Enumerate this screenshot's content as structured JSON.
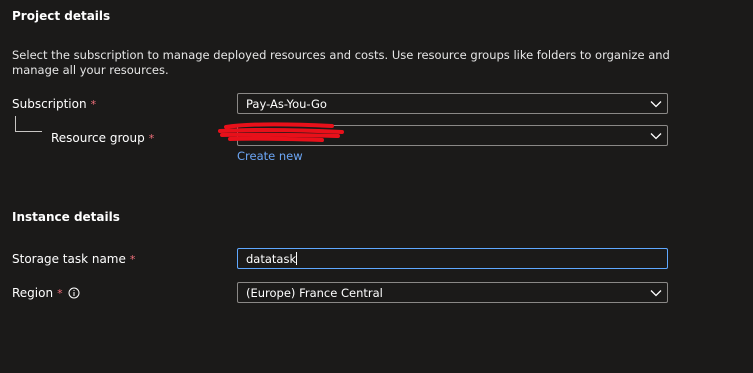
{
  "project": {
    "title": "Project details",
    "description": "Select the subscription to manage deployed resources and costs. Use resource groups like folders to organize and manage all your resources."
  },
  "subscription": {
    "label": "Subscription",
    "required": "*",
    "value": "Pay-As-You-Go"
  },
  "resource_group": {
    "label": "Resource group",
    "required": "*",
    "value": "",
    "create_new": "Create new"
  },
  "instance": {
    "title": "Instance details"
  },
  "storage_task": {
    "label": "Storage task name",
    "required": "*",
    "value": "datatask"
  },
  "region": {
    "label": "Region",
    "required": "*",
    "value": "(Europe) France Central"
  },
  "icons": {
    "dropdown": "chevron-down-icon",
    "info": "info-icon"
  },
  "colors": {
    "background": "#1b1a19",
    "required_asterisk": "#f1707b",
    "link": "#6ca6f5",
    "focus_border": "#5fa8ff",
    "redaction": "#e8101a"
  }
}
